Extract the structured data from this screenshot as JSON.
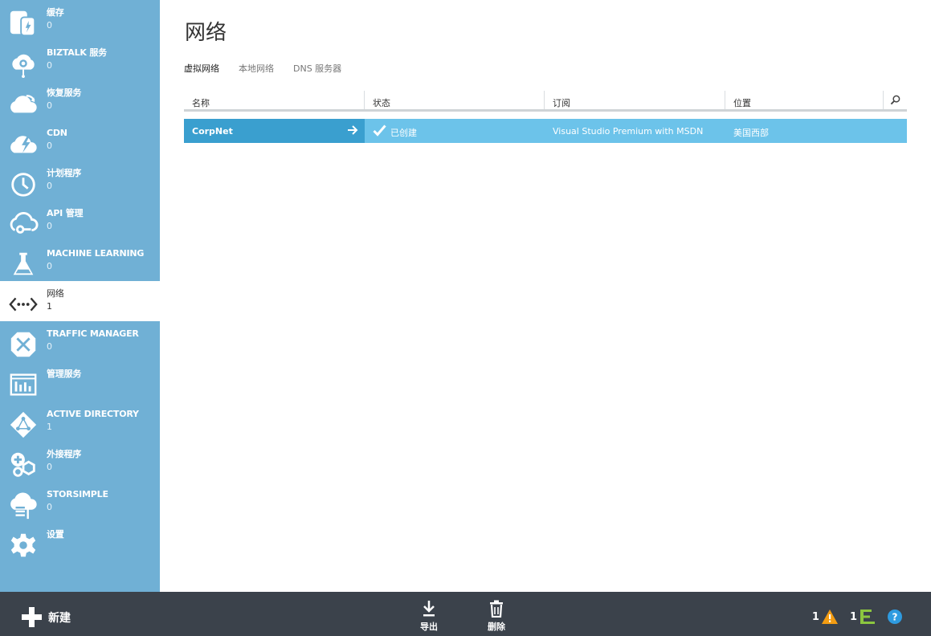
{
  "sidebar": {
    "items": [
      {
        "label": "缓存",
        "count": "0",
        "icon": "cache-icon"
      },
      {
        "label": "BIZTALK 服务",
        "count": "0",
        "icon": "biztalk-icon"
      },
      {
        "label": "恢复服务",
        "count": "0",
        "icon": "recovery-icon"
      },
      {
        "label": "CDN",
        "count": "0",
        "icon": "cdn-icon"
      },
      {
        "label": "计划程序",
        "count": "0",
        "icon": "scheduler-icon"
      },
      {
        "label": "API 管理",
        "count": "0",
        "icon": "api-management-icon"
      },
      {
        "label": "MACHINE LEARNING",
        "count": "0",
        "icon": "machine-learning-icon"
      },
      {
        "label": "网络",
        "count": "1",
        "icon": "network-icon",
        "active": true
      },
      {
        "label": "TRAFFIC MANAGER",
        "count": "0",
        "icon": "traffic-manager-icon"
      },
      {
        "label": "管理服务",
        "count": "",
        "icon": "management-services-icon"
      },
      {
        "label": "ACTIVE DIRECTORY",
        "count": "1",
        "icon": "active-directory-icon"
      },
      {
        "label": "外接程序",
        "count": "0",
        "icon": "add-ons-icon"
      },
      {
        "label": "STORSIMPLE",
        "count": "0",
        "icon": "storsimple-icon"
      },
      {
        "label": "设置",
        "count": "",
        "icon": "settings-icon"
      }
    ]
  },
  "main": {
    "title": "网络",
    "tabs": [
      {
        "label": "虚拟网络",
        "active": true
      },
      {
        "label": "本地网络",
        "active": false
      },
      {
        "label": "DNS 服务器",
        "active": false
      }
    ],
    "grid": {
      "columns": [
        "名称",
        "状态",
        "订阅",
        "位置"
      ],
      "rows": [
        {
          "name": "CorpNet",
          "status": "已创建",
          "subscription": "Visual Studio Premium with MSDN",
          "location": "美国西部"
        }
      ]
    }
  },
  "bottombar": {
    "new_label": "新建",
    "export_label": "导出",
    "delete_label": "删除",
    "warning_count": "1",
    "progress_count": "1"
  },
  "colors": {
    "sidebar_bg": "#70b0d5",
    "row_bg": "#6cc3ea",
    "row_name_bg": "#3a9fcf",
    "bottombar_bg": "#3b424b",
    "warning": "#f39c12",
    "progress": "#8cc63f",
    "help": "#2e9be0"
  }
}
